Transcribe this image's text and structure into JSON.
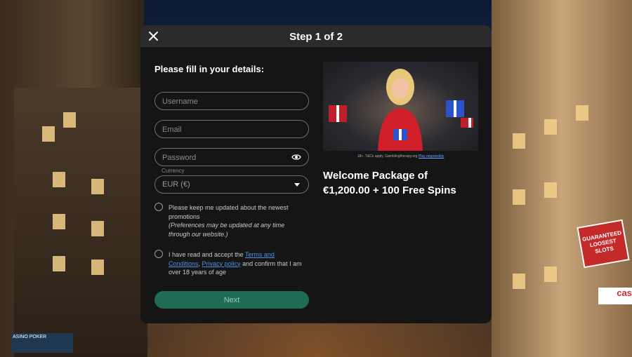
{
  "modal": {
    "title": "Step 1 of 2",
    "form_heading": "Please fill in your details:",
    "fields": {
      "username_placeholder": "Username",
      "email_placeholder": "Email",
      "password_placeholder": "Password",
      "currency_label": "Currency",
      "currency_value": "EUR (€)"
    },
    "consent_promotions": {
      "text": "Please keep me updated about the newest promotions",
      "note": "(Preferences may be updated at any time through our website.)"
    },
    "consent_terms": {
      "prefix": "I have read and accept the ",
      "terms_link": "Terms and Conditions",
      "separator": ", ",
      "privacy_link": "Privacy policy",
      "suffix": " and confirm that I am over 18 years of age"
    },
    "next_label": "Next",
    "promo": {
      "caption_prefix": "18+. T&Cs apply. Gamblingtherapy.org ",
      "caption_link": "Play responsibly",
      "title_line1": "Welcome Package of",
      "title_line2": "€1,200.00 + 100 Free Spins"
    }
  },
  "background": {
    "sign_text": "GUARANTEED LOOSEST SLOTS",
    "casino_sign": "cas",
    "logo_text": "ASINO POKER"
  },
  "colors": {
    "modal_bg": "#151515",
    "header_bg": "#2b2b2b",
    "accent_green": "#1f6b55",
    "link_blue": "#4a90e2"
  }
}
